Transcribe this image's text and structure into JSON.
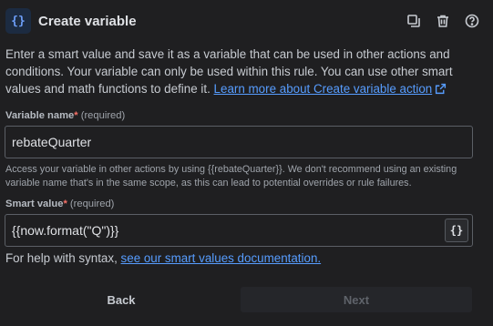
{
  "header": {
    "icon_glyph": "{}",
    "title": "Create variable",
    "actions": [
      {
        "name": "duplicate-icon"
      },
      {
        "name": "trash-icon"
      },
      {
        "name": "help-icon"
      }
    ]
  },
  "description": {
    "text": "Enter a smart value and save it as a variable that can be used in other actions and conditions. Your variable can only be used within this rule. You can use other smart values and math functions to define it.",
    "link": "Learn more about Create variable action"
  },
  "variable_name": {
    "label": "Variable name",
    "required_mark": "*",
    "required_text": "(required)",
    "value": "rebateQuarter",
    "help": "Access your variable in other actions by using {{rebateQuarter}}. We don't recommend using an existing variable name that's in the same scope, as this can lead to potential overrides or rule failures."
  },
  "smart_value": {
    "label": "Smart value",
    "required_mark": "*",
    "required_text": "(required)",
    "value": "{{now.format(\"Q\")}}",
    "insert_button_glyph": "{}"
  },
  "syntax_help": {
    "text": "For help with syntax,",
    "link": "see our smart values documentation."
  },
  "footer": {
    "back_label": "Back",
    "next_label": "Next"
  },
  "colors": {
    "background": "#1f1f21",
    "link": "#579dff",
    "required": "#f87168",
    "icon_bg": "#1c2b41"
  }
}
